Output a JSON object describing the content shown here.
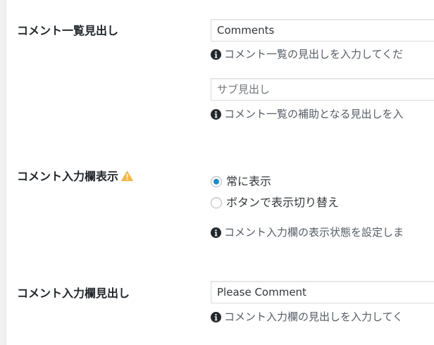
{
  "comment_list_heading": {
    "label": "コメント一覧見出し",
    "value": "Comments",
    "description": "コメント一覧の見出しを入力してくだ"
  },
  "sub_heading": {
    "placeholder": "サブ見出し",
    "description": "コメント一覧の補助となる見出しを入"
  },
  "comment_form_display": {
    "label": "コメント入力欄表示",
    "options": [
      {
        "label": "常に表示",
        "checked": true
      },
      {
        "label": "ボタンで表示切り替え",
        "checked": false
      }
    ],
    "description": "コメント入力欄の表示状態を設定しま"
  },
  "comment_form_heading": {
    "label": "コメント入力欄見出し",
    "value": "Please Comment",
    "description": "コメント入力欄の見出しを入力してく"
  },
  "colors": {
    "radio_checked": "#1e8cbe",
    "warning": "#f0b849"
  },
  "icons": {
    "info": "info-circle-icon",
    "warning": "warning-triangle-icon"
  }
}
